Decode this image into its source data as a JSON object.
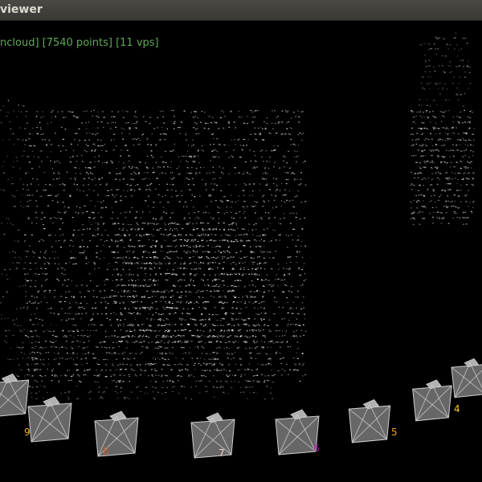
{
  "window": {
    "title": "viewer"
  },
  "viewport": {
    "status_text": "ncloud] [7540 points] [11 vps]"
  },
  "viewpoints": [
    {
      "label": "",
      "color": "#f0c040"
    },
    {
      "label": "9",
      "color": "#f0b020"
    },
    {
      "label": "8",
      "color": "#c06030"
    },
    {
      "label": "7",
      "color": "#f0d0d0"
    },
    {
      "label": "6",
      "color": "#b020b0"
    },
    {
      "label": "5",
      "color": "#f0a020"
    },
    {
      "label": "4",
      "color": "#f0d020"
    },
    {
      "label": "",
      "color": "#f0d020"
    }
  ],
  "colors": {
    "background": "#000000",
    "points": "#e8e8f0",
    "camera_fill": "#8a8a8a",
    "camera_edge": "#cfcfcf",
    "status_text": "#5fa858",
    "titlebar": "#3e3d39"
  }
}
